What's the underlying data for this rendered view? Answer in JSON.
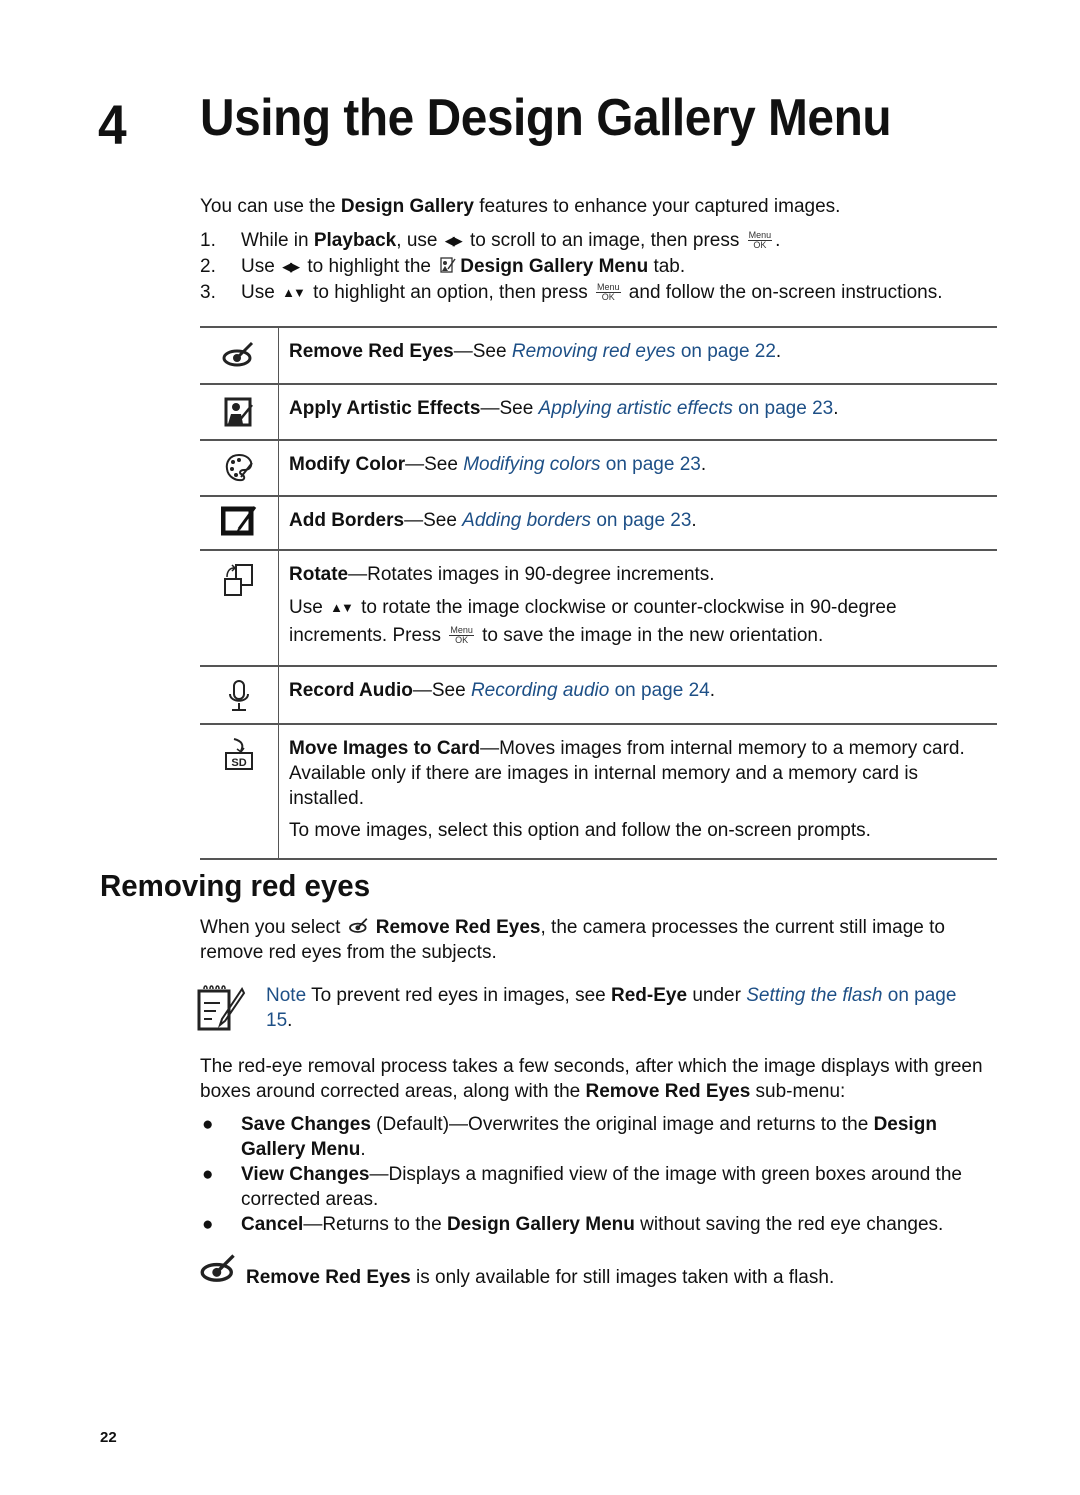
{
  "chapter": {
    "number": "4",
    "title": "Using the Design Gallery Menu"
  },
  "intro": {
    "pre": "You can use the ",
    "bold": "Design Gallery",
    "post": " features to enhance your captured images."
  },
  "steps": [
    {
      "num": "1.",
      "a": "While in ",
      "b": "Playback",
      "c": ", use ",
      "d": " to scroll to an image, then press ",
      "e": "."
    },
    {
      "num": "2.",
      "a": "Use ",
      "c": " to highlight the ",
      "b": "Design Gallery Menu",
      "e": " tab."
    },
    {
      "num": "3.",
      "a": "Use ",
      "c": " to highlight an option, then press ",
      "e": " and follow the on-screen instructions."
    }
  ],
  "keys": {
    "lr": "◀▶",
    "ud": "▲▼",
    "menu_top": "Menu",
    "menu_bottom": "OK"
  },
  "menu_items": [
    {
      "icon": "red-eye-icon",
      "bold": "Remove Red Eyes",
      "dash": "—See ",
      "link": "Removing red eyes",
      "page": " on page 22",
      "end": "."
    },
    {
      "icon": "artistic-effects-icon",
      "bold": "Apply Artistic Effects",
      "dash": "—See ",
      "link": "Applying artistic effects",
      "page": " on page 23",
      "end": "."
    },
    {
      "icon": "palette-icon",
      "bold": "Modify Color",
      "dash": "—See ",
      "link": "Modifying colors",
      "page": " on page 23",
      "end": "."
    },
    {
      "icon": "borders-icon",
      "bold": "Add Borders",
      "dash": "—See ",
      "link": "Adding borders",
      "page": " on page 23",
      "end": "."
    },
    {
      "icon": "rotate-icon",
      "bold": "Rotate",
      "dash": "—Rotates images in 90-degree increments.",
      "extra_a": "Use ",
      "extra_b": " to rotate the image clockwise or counter-clockwise in 90-degree increments. Press ",
      "extra_c": " to save the image in the new orientation."
    },
    {
      "icon": "microphone-icon",
      "bold": "Record Audio",
      "dash": "—See ",
      "link": "Recording audio",
      "page": " on page 24",
      "end": "."
    },
    {
      "icon": "sd-card-icon",
      "bold": "Move Images to Card",
      "dash": "—Moves images from internal memory to a memory card. Available only if there are images in internal memory and a memory card is installed.",
      "extra": "To move images, select this option and follow the on-screen prompts."
    }
  ],
  "section": {
    "title": "Removing red eyes"
  },
  "para1": {
    "a": "When you select ",
    "b": "Remove Red Eyes",
    "c": ", the camera processes the current still image to remove red eyes from the subjects."
  },
  "note": {
    "label": "Note",
    "a": "  To prevent red eyes in images, see ",
    "b": "Red-Eye",
    "c": " under ",
    "link": "Setting the flash",
    "page": "on page 15",
    "end": "."
  },
  "para2": {
    "a": "The red-eye removal process takes a few seconds, after which the image displays with green boxes around corrected areas, along with the ",
    "b": "Remove Red Eyes",
    "c": " sub-menu:"
  },
  "bullets": [
    {
      "b": "Save Changes",
      "a": " (Default)—Overwrites the original image and returns to the ",
      "b2": "Design Gallery Menu",
      "e": "."
    },
    {
      "b": "View Changes",
      "a": "—Displays a magnified view of the image with green boxes around the corrected areas.",
      "b2": "",
      "e": ""
    },
    {
      "b": "Cancel",
      "a": "—Returns to the ",
      "b2": "Design Gallery Menu",
      "e": " without saving the red eye changes."
    }
  ],
  "bullet_char": "●",
  "tail": {
    "b": "Remove Red Eyes",
    "a": " is only available for still images taken with a flash."
  },
  "page_number": "22",
  "colors": {
    "link": "#1d4f86",
    "text": "#111111",
    "rule": "#555555"
  }
}
